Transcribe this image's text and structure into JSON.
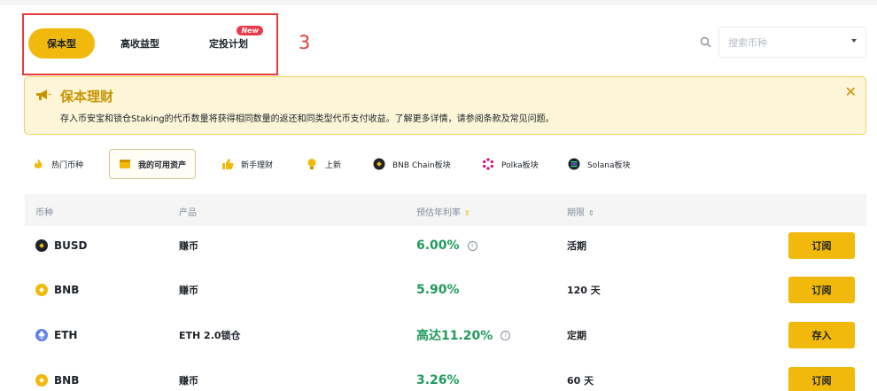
{
  "tabs": [
    {
      "label": "保本型",
      "active": true
    },
    {
      "label": "高收益型",
      "active": false
    },
    {
      "label": "定投计划",
      "active": false,
      "badge": "New"
    }
  ],
  "annotation": "3",
  "search": {
    "placeholder": "搜索币种"
  },
  "banner": {
    "title": "保本理财",
    "text": "存入币安宝和锁仓Staking的代币数量将获得相同数量的返还和同类型代币支付收益。了解更多详情，请参阅条款及常见问题。",
    "close": "✕"
  },
  "categories": [
    {
      "label": "热门币种",
      "icon": "fire-icon"
    },
    {
      "label": "我的可用资产",
      "icon": "wallet-icon",
      "active": true
    },
    {
      "label": "新手理财",
      "icon": "thumbs-up-icon"
    },
    {
      "label": "上新",
      "icon": "bulb-icon"
    },
    {
      "label": "BNB Chain板块",
      "icon": "bnb-chain-icon"
    },
    {
      "label": "Polka板块",
      "icon": "polkadot-icon"
    },
    {
      "label": "Solana板块",
      "icon": "solana-icon"
    }
  ],
  "table": {
    "headers": {
      "coin": "币种",
      "product": "产品",
      "apy": "预估年利率",
      "term": "期限"
    },
    "rows": [
      {
        "coin": "BUSD",
        "product": "赚币",
        "apy": "6.00%",
        "has_info": true,
        "term": "活期",
        "action": "订阅"
      },
      {
        "coin": "BNB",
        "product": "赚币",
        "apy": "5.90%",
        "has_info": false,
        "term": "120 天",
        "action": "订阅"
      },
      {
        "coin": "ETH",
        "product": "ETH 2.0锁仓",
        "apy": "高达11.20%",
        "has_info": true,
        "term": "定期",
        "action": "存入"
      },
      {
        "coin": "BNB",
        "product": "赚币",
        "apy": "3.26%",
        "has_info": false,
        "term": "60 天",
        "action": "订阅"
      }
    ]
  },
  "colors": {
    "accent": "#f0b90b",
    "positive": "#1f9b5b",
    "banner_bg": "#fdf5d7",
    "annotation": "#e63b3b"
  }
}
